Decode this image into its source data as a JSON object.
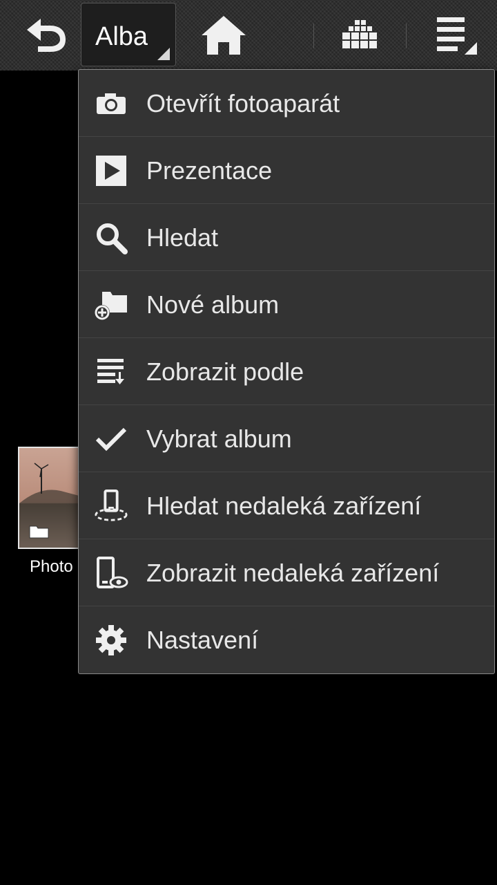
{
  "actionbar": {
    "spinner_label": "Alba",
    "icons": [
      "back-icon",
      "home-icon",
      "grid-view-icon",
      "overflow-menu-icon"
    ]
  },
  "album": {
    "label": "Photo"
  },
  "menu": {
    "items": [
      {
        "label": "Otevřít fotoaparát",
        "icon": "camera-icon"
      },
      {
        "label": "Prezentace",
        "icon": "play-icon"
      },
      {
        "label": "Hledat",
        "icon": "search-icon"
      },
      {
        "label": "Nové album",
        "icon": "new-folder-icon"
      },
      {
        "label": "Zobrazit podle",
        "icon": "sort-list-icon"
      },
      {
        "label": "Vybrat album",
        "icon": "checkmark-icon"
      },
      {
        "label": "Hledat nedaleká zařízení",
        "icon": "nearby-scan-icon"
      },
      {
        "label": "Zobrazit nedaleká zařízení",
        "icon": "nearby-view-icon"
      },
      {
        "label": "Nastavení",
        "icon": "gear-icon"
      }
    ]
  },
  "colors": {
    "menu_bg": "#333333",
    "text": "#e8e8e8",
    "background": "#000000"
  }
}
